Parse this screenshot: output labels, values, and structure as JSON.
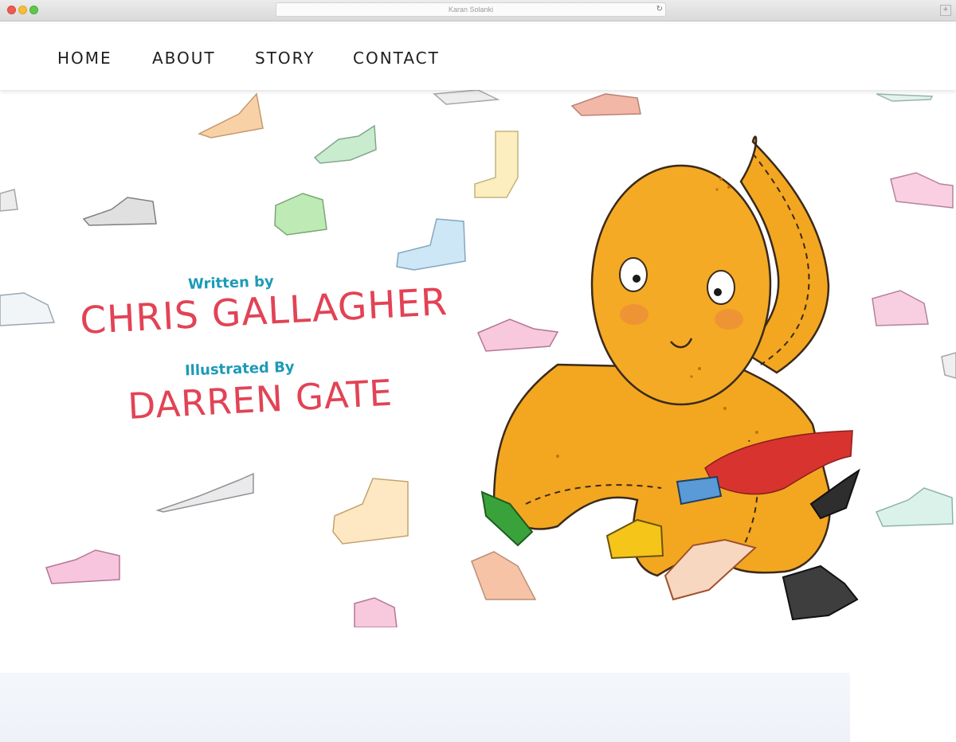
{
  "browser": {
    "url_title": "Karan Solanki"
  },
  "nav": {
    "home": "HOME",
    "about": "ABOUT",
    "story": "STORY",
    "contact": "CONTACT"
  },
  "hero": {
    "written_by_label": "Written by",
    "author": "CHRIS GALLAGHER",
    "illustrated_by_label": "Illustrated By",
    "illustrator": "DARREN GATE"
  },
  "colors": {
    "label_blue": "#1c9ab7",
    "name_red": "#e24355",
    "octopus_orange": "#f3a720",
    "cape_red": "#d8332f"
  },
  "icons": [
    "reload-icon",
    "new-tab-icon",
    "octopus-illustration",
    "shoe-illustration"
  ]
}
